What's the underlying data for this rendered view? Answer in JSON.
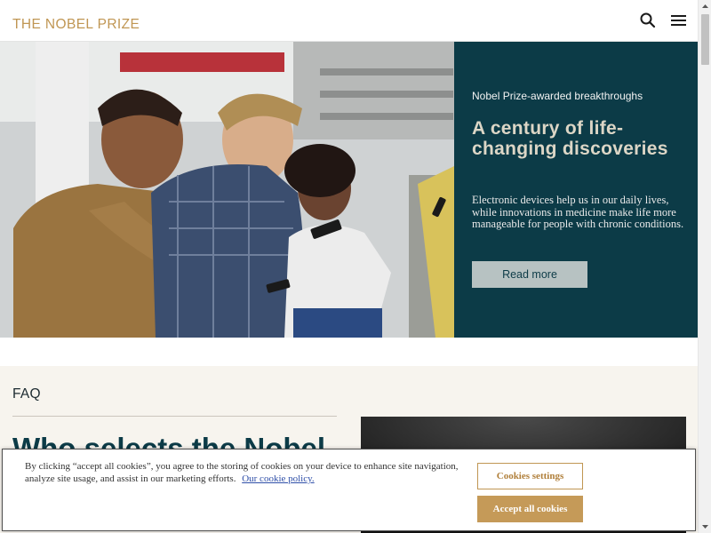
{
  "header": {
    "logo": "THE NOBEL PRIZE",
    "search_icon": "search-icon",
    "menu_icon": "menu-icon",
    "brand_color": "#c09653"
  },
  "hero": {
    "image": "photo-people-looking-at-phones",
    "kicker": "Nobel Prize-awarded breakthroughs",
    "title": "A century of life-changing discoveries",
    "text": "Electronic devices help us in our daily lives, while innovations in medicine make life more manageable for people with chronic conditions.",
    "button_label": "Read more",
    "panel_color": "#0c3b47"
  },
  "faq": {
    "label": "FAQ",
    "heading": "Who selects the Nobel",
    "image": "dark-photo"
  },
  "cookie": {
    "text": "By clicking “accept all cookies”, you agree to the storing of cookies on your device to enhance site navigation, analyze site usage, and assist in our marketing efforts.",
    "link": "Our cookie policy.",
    "settings_label": "Cookies settings",
    "accept_label": "Accept all cookies"
  }
}
